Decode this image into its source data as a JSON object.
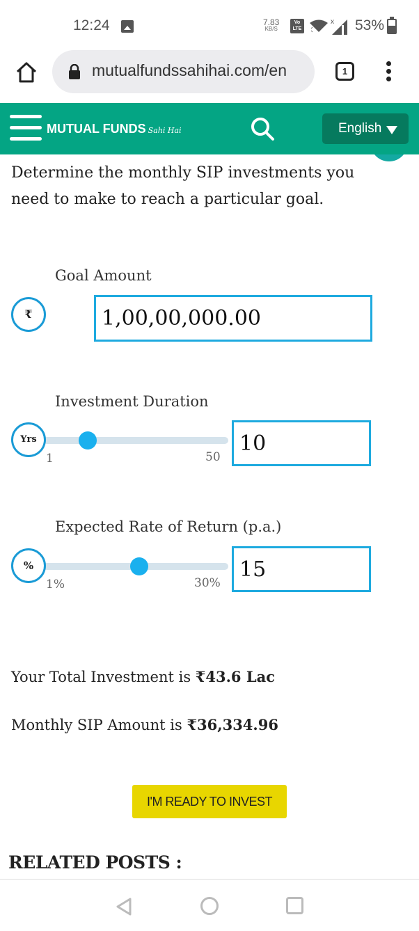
{
  "status_bar": {
    "time": "12:24",
    "net_speed_value": "7.83",
    "net_speed_unit": "KB/S",
    "volte_label": "Vo LTE",
    "battery_percent": "53%",
    "icons": [
      "gallery-icon",
      "volte-icon",
      "wifi-icon",
      "signal-icon",
      "battery-icon"
    ]
  },
  "browser": {
    "url": "mutualfundssahihai.com/en",
    "tab_count": "1",
    "icons": [
      "home-icon",
      "lock-icon",
      "tabs-icon",
      "overflow-menu-icon"
    ]
  },
  "site_header": {
    "logo_main": "MUTUAL FUNDS",
    "logo_script": "Sahi Hai",
    "language": "English",
    "icons": [
      "hamburger-icon",
      "search-icon",
      "dropdown-arrow-icon"
    ]
  },
  "calculator": {
    "intro": "Determine the monthly SIP investments you need to make to reach a particular goal.",
    "goal": {
      "label": "Goal Amount",
      "icon_text": "₹",
      "value": "1,00,00,000.00"
    },
    "duration": {
      "label": "Investment Duration",
      "icon_text": "Yrs",
      "value": "10",
      "min_label": "1",
      "max_label": "50",
      "min": 1,
      "max": 50,
      "current": 10
    },
    "rate": {
      "label": "Expected Rate of Return (p.a.)",
      "icon_text": "%",
      "value": "15",
      "min_label": "1%",
      "max_label": "30%",
      "min": 1,
      "max": 30,
      "current": 15
    },
    "results": {
      "total_prefix": "Your Total Investment is ",
      "total_value": "₹43.6 Lac",
      "sip_prefix": "Monthly SIP Amount is ",
      "sip_value": "₹36,334.96"
    },
    "cta_label": "I'M READY TO INVEST"
  },
  "related_heading": "RELATED POSTS :",
  "colors": {
    "header_green": "#04a584",
    "lang_button": "#067a5e",
    "input_border": "#1eaadf",
    "slider_thumb": "#1ab0ee",
    "cta_yellow": "#e8d600"
  },
  "nav_bar": {
    "icons": [
      "back-icon",
      "home-circle-icon",
      "recents-icon"
    ]
  }
}
